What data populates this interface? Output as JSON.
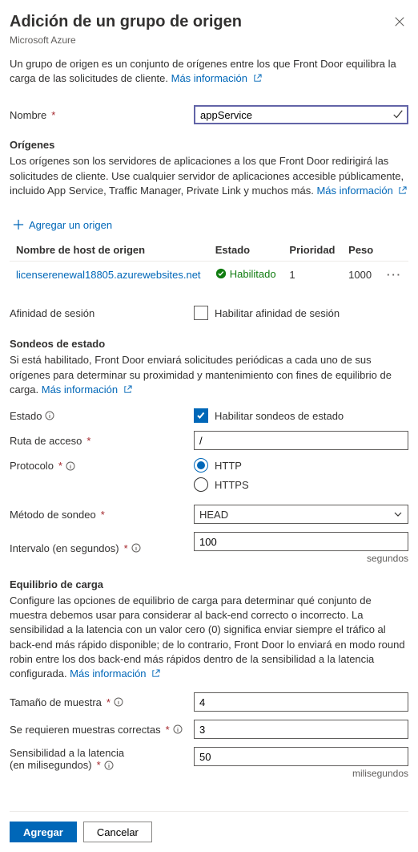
{
  "header": {
    "title": "Adición de un grupo de origen",
    "subtitle": "Microsoft Azure"
  },
  "intro": {
    "text": "Un grupo de origen es un conjunto de orígenes entre los que Front Door equilibra la carga de las solicitudes de cliente. ",
    "link": "Más información"
  },
  "name": {
    "label": "Nombre",
    "value": "appService"
  },
  "origins": {
    "heading": "Orígenes",
    "desc": "Los orígenes son los servidores de aplicaciones a los que Front Door redirigirá las solicitudes de cliente. Use cualquier servidor de aplicaciones accesible públicamente, incluido App Service, Traffic Manager, Private Link y muchos más. ",
    "link": "Más información",
    "add": "Agregar un origen",
    "cols": {
      "host": "Nombre de host de origen",
      "status": "Estado",
      "priority": "Prioridad",
      "weight": "Peso"
    },
    "rows": [
      {
        "host": "licenserenewal18805.azurewebsites.net",
        "status": "Habilitado",
        "priority": "1",
        "weight": "1000"
      }
    ]
  },
  "affinity": {
    "label": "Afinidad de sesión",
    "check": "Habilitar afinidad de sesión"
  },
  "probes": {
    "heading": "Sondeos de estado",
    "desc": "Si está habilitado, Front Door enviará solicitudes periódicas a cada uno de sus orígenes para determinar su proximidad y mantenimiento con fines de equilibrio de carga. ",
    "link": "Más información",
    "status_label": "Estado",
    "status_check": "Habilitar sondeos de estado",
    "path_label": "Ruta de acceso",
    "path_value": "/",
    "protocol_label": "Protocolo",
    "protocol_http": "HTTP",
    "protocol_https": "HTTPS",
    "method_label": "Método de sondeo",
    "method_value": "HEAD",
    "interval_label": "Intervalo (en segundos)",
    "interval_value": "100",
    "interval_unit": "segundos"
  },
  "lb": {
    "heading": "Equilibrio de carga",
    "desc": "Configure las opciones de equilibrio de carga para determinar qué conjunto de muestra debemos usar para considerar al back-end correcto o incorrecto. La sensibilidad a la latencia con un valor cero (0) significa enviar siempre el tráfico al back-end más rápido disponible; de lo contrario, Front Door lo enviará en modo round robin entre los dos back-end más rápidos dentro de la sensibilidad a la latencia configurada. ",
    "link": "Más información",
    "sample_label": "Tamaño de muestra",
    "sample_value": "4",
    "successful_label": "Se requieren muestras correctas",
    "successful_value": "3",
    "latency_label_l1": "Sensibilidad a la latencia",
    "latency_label_l2": "(en milisegundos)",
    "latency_value": "50",
    "latency_unit": "milisegundos"
  },
  "footer": {
    "add": "Agregar",
    "cancel": "Cancelar"
  }
}
